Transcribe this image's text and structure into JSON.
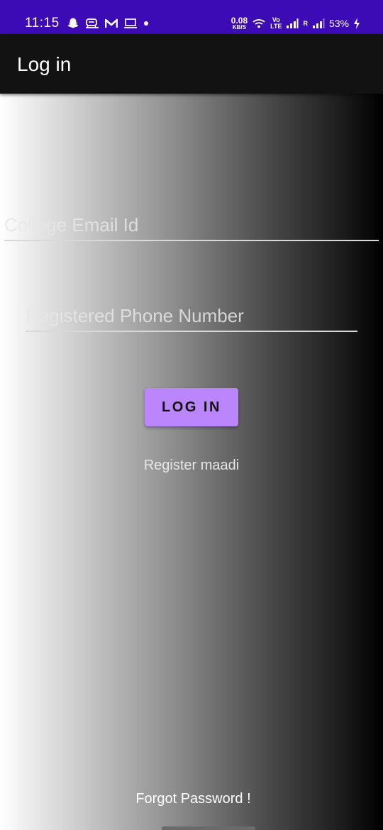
{
  "status_bar": {
    "time": "11:15",
    "net_speed_value": "0.08",
    "net_speed_unit": "KB/S",
    "volte_top": "Vo",
    "volte_bottom": "LTE",
    "roaming": "R",
    "battery": "53%",
    "background_color": "#3d0bb5",
    "icons_left": [
      "snapchat-icon",
      "train-icon",
      "gmail-icon",
      "laptop-icon",
      "dot-icon"
    ],
    "icons_right": [
      "wifi-icon",
      "signal-icon",
      "signal-roaming-icon",
      "charging-icon"
    ]
  },
  "app_bar": {
    "title": "Log in"
  },
  "form": {
    "email_placeholder": "College Email Id",
    "phone_placeholder": "Registered Phone Number",
    "login_label": "LOG IN",
    "register_label": "Register maadi",
    "forgot_label": "Forgot Password !",
    "accent_color": "#bb86fc"
  }
}
